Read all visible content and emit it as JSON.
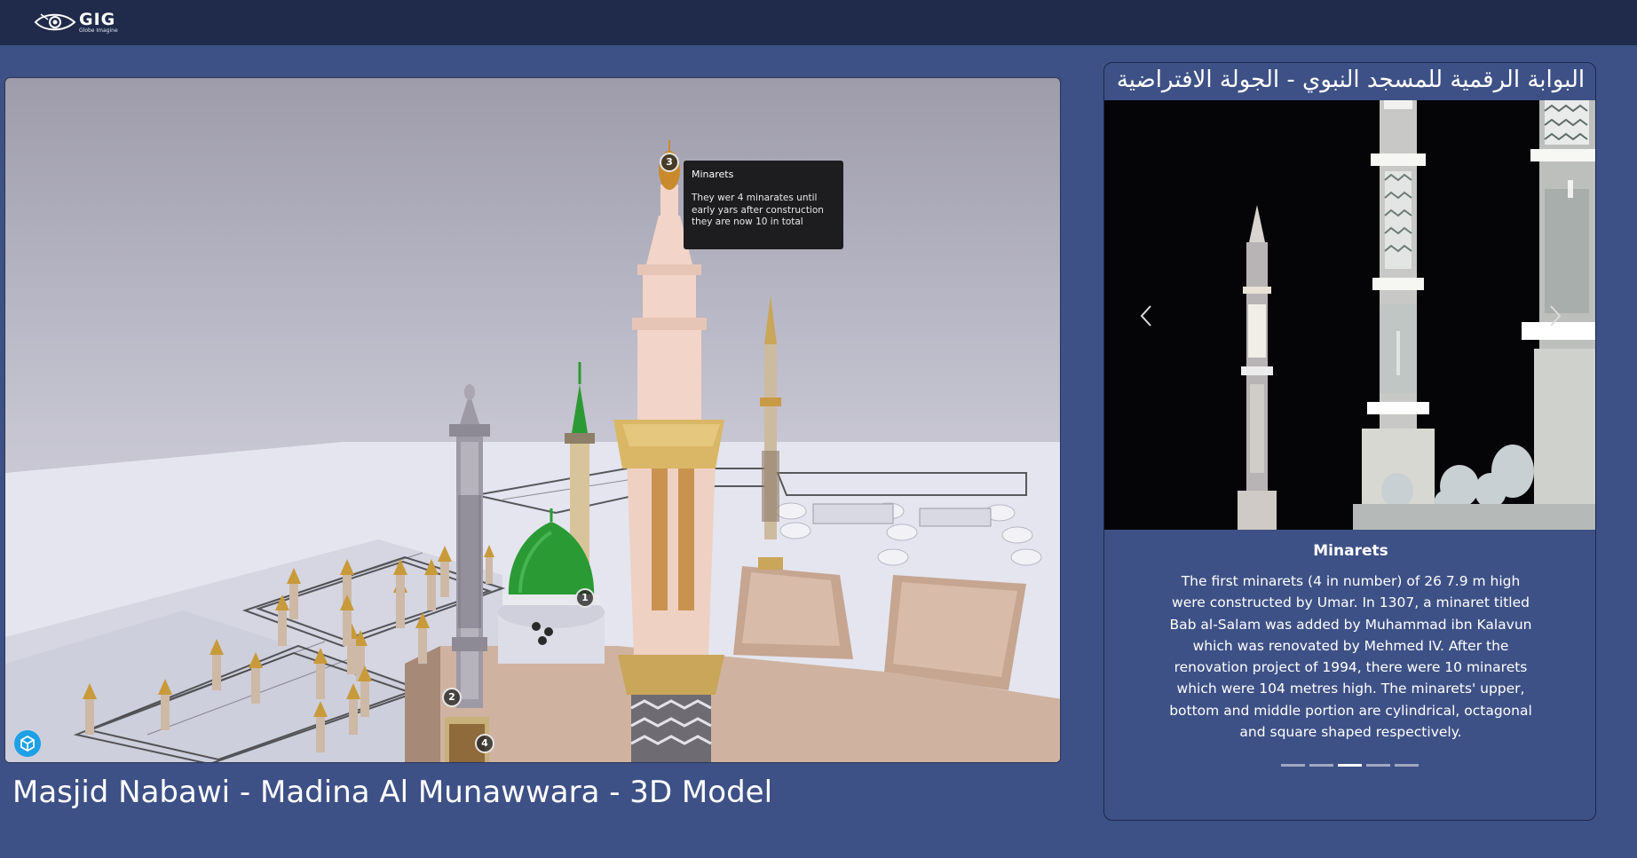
{
  "header": {
    "logo_main": "GIG",
    "logo_sub": "Globe Imagine"
  },
  "viewer": {
    "title": "Masjid Nabawi - Madina Al Munawwara - 3D Model",
    "hotspots": [
      "1",
      "2",
      "3",
      "4"
    ],
    "tooltip": {
      "title": "Minarets",
      "body": "They wer 4 minarates until early yars after construction they are now 10 in total"
    }
  },
  "panel": {
    "heading": "البوابة الرقمية للمسجد النبوي - الجولة الافتراضية",
    "slide": {
      "title": "Minarets",
      "body": "The first minarets (4 in number) of 26 7.9 m high were constructed by Umar. In 1307, a minaret titled Bab al-Salam was added by Muhammad ibn Kalavun which was renovated by Mehmed IV. After the renovation project of 1994, there were 10 minarets which were 104 metres high. The minarets' upper, bottom and middle portion are cylindrical, octagonal and square shaped respectively."
    },
    "indicator_count": 5,
    "active_indicator": 3
  },
  "colors": {
    "page_bg": "#3e5186",
    "topbar_bg": "#202b4b",
    "dome_green": "#2a9a35",
    "badge_blue": "#1ea0e6"
  },
  "icons": [
    "eye-logo-icon",
    "chevron-left-icon",
    "chevron-right-icon",
    "cube-icon"
  ]
}
